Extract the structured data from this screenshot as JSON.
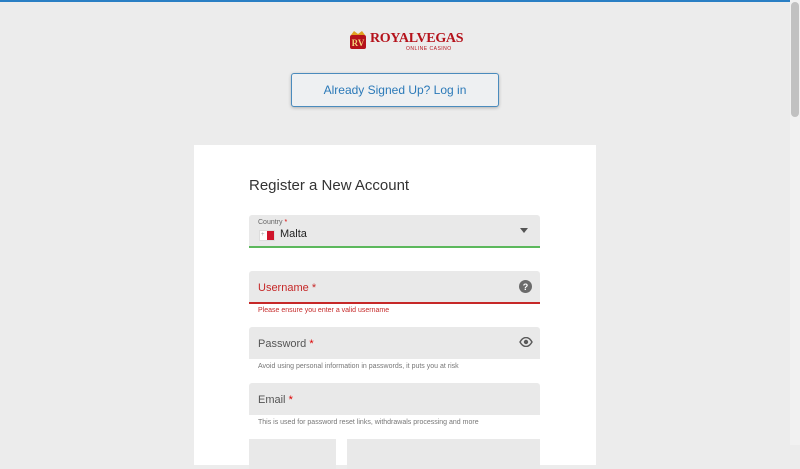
{
  "brand": {
    "logo_badge": "RV",
    "logo_text": "ROYALVEGAS",
    "logo_subtext": "ONLINE CASINO",
    "brand_color": "#b5121b"
  },
  "login_button": {
    "label": "Already Signed Up? Log in"
  },
  "form": {
    "title": "Register a New Account",
    "country": {
      "label": "Country",
      "required_mark": "*",
      "value": "Malta",
      "flag_icon": "malta-flag-icon"
    },
    "username": {
      "label": "Username",
      "required_mark": "*",
      "help_icon": "?",
      "error": "Please ensure you enter a valid username"
    },
    "password": {
      "label": "Password",
      "required_mark": "*",
      "hint": "Avoid using personal information in passwords, it puts you at risk"
    },
    "email": {
      "label": "Email",
      "required_mark": "*",
      "hint": "This is used for password reset links, withdrawals processing and more"
    }
  },
  "colors": {
    "accent": "#2b79b8",
    "error": "#c62828",
    "valid": "#5cb85c"
  }
}
